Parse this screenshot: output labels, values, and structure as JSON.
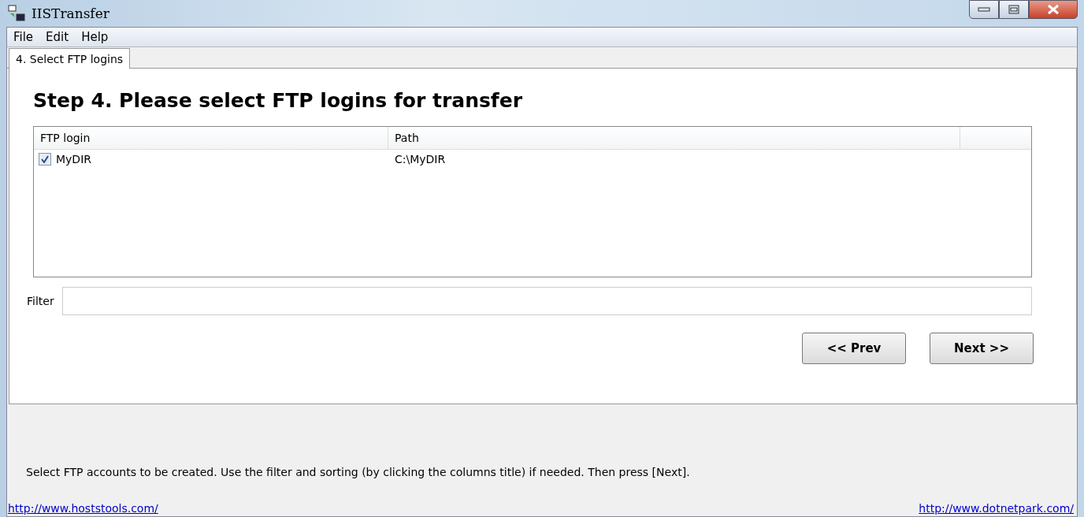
{
  "window": {
    "title": "IISTransfer"
  },
  "menu": [
    "File",
    "Edit",
    "Help"
  ],
  "tabs": [
    {
      "label": "4. Select FTP logins",
      "selected": true
    }
  ],
  "heading": "Step 4. Please select FTP logins for transfer",
  "table": {
    "columns": [
      "FTP login",
      "Path"
    ],
    "rows": [
      {
        "checked": true,
        "cells": [
          "MyDIR",
          "C:\\MyDIR"
        ]
      }
    ]
  },
  "filter": {
    "label": "Filter"
  },
  "buttons": [
    "<< Prev",
    "Next >>"
  ],
  "hint": "Select FTP accounts to be created. Use the filter and sorting (by clicking the columns title) if needed. Then press [Next].",
  "links": [
    "http://www.hoststools.com/",
    "http://www.dotnetpark.com/"
  ]
}
